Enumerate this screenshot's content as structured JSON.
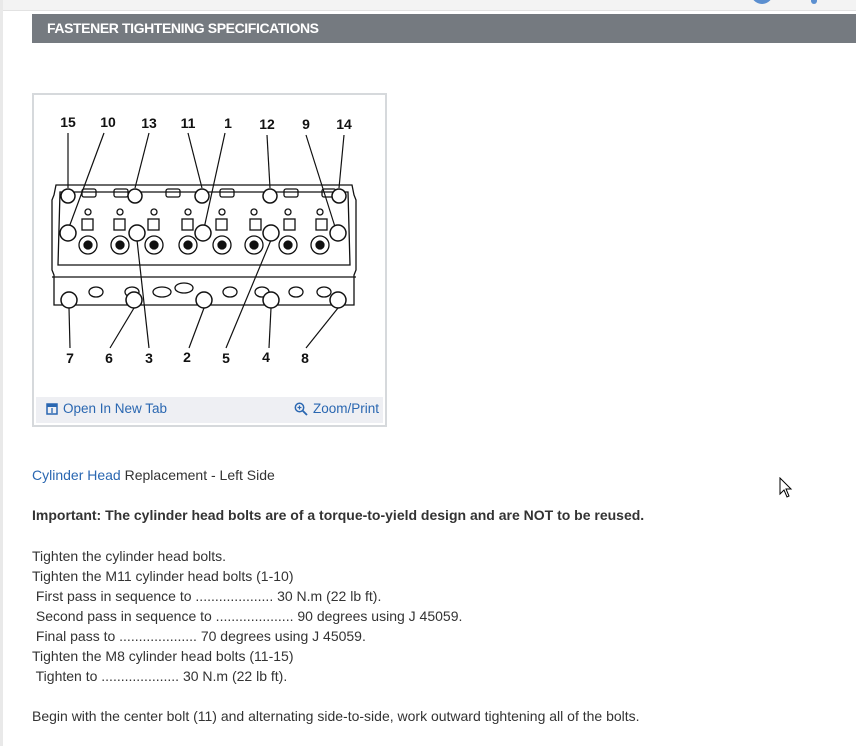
{
  "section": {
    "title": "FASTENER TIGHTENING SPECIFICATIONS"
  },
  "figure": {
    "top_labels": [
      "15",
      "10",
      "13",
      "11",
      "1",
      "12",
      "9",
      "14"
    ],
    "bottom_labels": [
      "7",
      "6",
      "3",
      "2",
      "5",
      "4",
      "8"
    ],
    "open_tab_label": "Open In New Tab",
    "zoom_label": "Zoom/Print"
  },
  "content": {
    "intro_link": "Cylinder Head",
    "intro_rest": " Replacement - Left Side",
    "important": "Important: The cylinder head bolts are of a torque-to-yield design and are NOT to be reused.",
    "steps": [
      "Tighten the cylinder head bolts.",
      "Tighten the M11 cylinder head bolts (1-10)",
      " First pass in sequence to .................... 30 N.m (22 lb ft).",
      " Second pass in sequence to .................... 90 degrees using J 45059.",
      " Final pass to .................... 70 degrees using J 45059.",
      "Tighten the M8 cylinder head bolts (11-15)",
      " Tighten to .................... 30 N.m (22 lb ft)."
    ],
    "closing": "Begin with the center bolt (11) and alternating side-to-side, work outward tightening all of the bolts."
  },
  "icons": {
    "open_tab": "open-new-tab-icon",
    "zoom": "zoom-icon",
    "cursor": "mouse-pointer-icon"
  },
  "colors": {
    "header_bg": "#757a80",
    "link": "#2a67b1",
    "figure_footer_bg": "#eeeff3"
  }
}
